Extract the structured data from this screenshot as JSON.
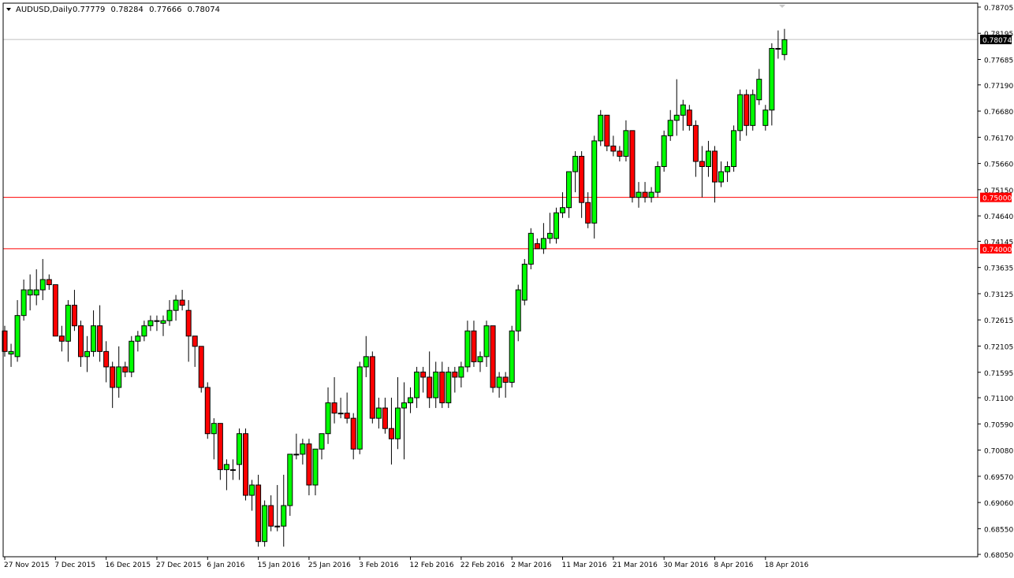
{
  "window": {
    "symbol": "AUDUSD,Daily",
    "ohlc": [
      "0.77779",
      "0.78284",
      "0.77666",
      "0.78074"
    ]
  },
  "colors": {
    "bull": "#00ff00",
    "bear": "#ff0000",
    "outline": "#000000",
    "level_line": "#ff0000",
    "current_line": "#c0c0c0",
    "background": "#ffffff"
  },
  "chart_data": {
    "type": "candlestick",
    "grid": false,
    "ylim": [
      0.6805,
      0.7872
    ],
    "y_ticks": [
      "0.78705",
      "0.78195",
      "0.77685",
      "0.77190",
      "0.76680",
      "0.76170",
      "0.75660",
      "0.75150",
      "0.74640",
      "0.74145",
      "0.73635",
      "0.73125",
      "0.72615",
      "0.72105",
      "0.71595",
      "0.71100",
      "0.70590",
      "0.70080",
      "0.69570",
      "0.69060",
      "0.68550",
      "0.68050"
    ],
    "x_labels": [
      {
        "index": 0,
        "label": "27 Nov 2015"
      },
      {
        "index": 8,
        "label": "7 Dec 2015"
      },
      {
        "index": 16,
        "label": "16 Dec 2015"
      },
      {
        "index": 24,
        "label": "27 Dec 2015"
      },
      {
        "index": 32,
        "label": "6 Jan 2016"
      },
      {
        "index": 40,
        "label": "15 Jan 2016"
      },
      {
        "index": 48,
        "label": "25 Jan 2016"
      },
      {
        "index": 56,
        "label": "3 Feb 2016"
      },
      {
        "index": 64,
        "label": "12 Feb 2016"
      },
      {
        "index": 72,
        "label": "22 Feb 2016"
      },
      {
        "index": 80,
        "label": "2 Mar 2016"
      },
      {
        "index": 88,
        "label": "11 Mar 2016"
      },
      {
        "index": 96,
        "label": "21 Mar 2016"
      },
      {
        "index": 104,
        "label": "30 Mar 2016"
      },
      {
        "index": 112,
        "label": "8 Apr 2016"
      },
      {
        "index": 120,
        "label": "18 Apr 2016"
      }
    ],
    "horizontal_lines": [
      {
        "value": 0.75,
        "label": "0.75000"
      },
      {
        "value": 0.74,
        "label": "0.74000"
      }
    ],
    "current_price": {
      "value": 0.78074,
      "label": "0.78074"
    },
    "candles": [
      [
        0.724,
        0.725,
        0.719,
        0.72
      ],
      [
        0.7195,
        0.7215,
        0.717,
        0.72
      ],
      [
        0.719,
        0.73,
        0.718,
        0.727
      ],
      [
        0.727,
        0.734,
        0.726,
        0.732
      ],
      [
        0.731,
        0.735,
        0.728,
        0.732
      ],
      [
        0.731,
        0.736,
        0.729,
        0.732
      ],
      [
        0.732,
        0.738,
        0.73,
        0.734
      ],
      [
        0.734,
        0.735,
        0.732,
        0.733
      ],
      [
        0.733,
        0.733,
        0.724,
        0.723
      ],
      [
        0.723,
        0.725,
        0.72,
        0.722
      ],
      [
        0.722,
        0.73,
        0.718,
        0.729
      ],
      [
        0.729,
        0.732,
        0.724,
        0.725
      ],
      [
        0.725,
        0.726,
        0.717,
        0.719
      ],
      [
        0.719,
        0.723,
        0.716,
        0.72
      ],
      [
        0.72,
        0.728,
        0.719,
        0.725
      ],
      [
        0.725,
        0.729,
        0.718,
        0.72
      ],
      [
        0.72,
        0.722,
        0.714,
        0.717
      ],
      [
        0.717,
        0.718,
        0.709,
        0.713
      ],
      [
        0.713,
        0.721,
        0.711,
        0.717
      ],
      [
        0.717,
        0.718,
        0.715,
        0.716
      ],
      [
        0.716,
        0.723,
        0.715,
        0.722
      ],
      [
        0.722,
        0.724,
        0.72,
        0.723
      ],
      [
        0.723,
        0.726,
        0.722,
        0.725
      ],
      [
        0.725,
        0.727,
        0.724,
        0.726
      ],
      [
        0.726,
        0.727,
        0.724,
        0.726
      ],
      [
        0.7255,
        0.727,
        0.723,
        0.726
      ],
      [
        0.726,
        0.73,
        0.725,
        0.728
      ],
      [
        0.728,
        0.731,
        0.726,
        0.73
      ],
      [
        0.73,
        0.732,
        0.728,
        0.729
      ],
      [
        0.728,
        0.73,
        0.718,
        0.723
      ],
      [
        0.723,
        0.723,
        0.717,
        0.721
      ],
      [
        0.721,
        0.721,
        0.712,
        0.713
      ],
      [
        0.713,
        0.714,
        0.703,
        0.704
      ],
      [
        0.704,
        0.707,
        0.699,
        0.706
      ],
      [
        0.706,
        0.706,
        0.695,
        0.697
      ],
      [
        0.697,
        0.699,
        0.693,
        0.698
      ],
      [
        0.697,
        0.699,
        0.695,
        0.697
      ],
      [
        0.698,
        0.705,
        0.695,
        0.704
      ],
      [
        0.704,
        0.705,
        0.691,
        0.692
      ],
      [
        0.692,
        0.695,
        0.689,
        0.694
      ],
      [
        0.694,
        0.696,
        0.682,
        0.683
      ],
      [
        0.683,
        0.691,
        0.682,
        0.69
      ],
      [
        0.69,
        0.692,
        0.685,
        0.686
      ],
      [
        0.686,
        0.694,
        0.685,
        0.686
      ],
      [
        0.686,
        0.696,
        0.682,
        0.69
      ],
      [
        0.69,
        0.7,
        0.688,
        0.7
      ],
      [
        0.7,
        0.704,
        0.699,
        0.7
      ],
      [
        0.7,
        0.703,
        0.698,
        0.702
      ],
      [
        0.702,
        0.703,
        0.692,
        0.694
      ],
      [
        0.694,
        0.701,
        0.692,
        0.701
      ],
      [
        0.701,
        0.704,
        0.699,
        0.704
      ],
      [
        0.704,
        0.713,
        0.702,
        0.71
      ],
      [
        0.71,
        0.715,
        0.706,
        0.708
      ],
      [
        0.708,
        0.711,
        0.707,
        0.708
      ],
      [
        0.708,
        0.712,
        0.706,
        0.707
      ],
      [
        0.707,
        0.708,
        0.699,
        0.701
      ],
      [
        0.701,
        0.718,
        0.7,
        0.717
      ],
      [
        0.717,
        0.723,
        0.715,
        0.719
      ],
      [
        0.719,
        0.72,
        0.706,
        0.707
      ],
      [
        0.707,
        0.711,
        0.705,
        0.709
      ],
      [
        0.709,
        0.711,
        0.704,
        0.705
      ],
      [
        0.705,
        0.711,
        0.698,
        0.703
      ],
      [
        0.703,
        0.715,
        0.701,
        0.709
      ],
      [
        0.709,
        0.714,
        0.699,
        0.71
      ],
      [
        0.71,
        0.713,
        0.708,
        0.711
      ],
      [
        0.711,
        0.717,
        0.709,
        0.716
      ],
      [
        0.716,
        0.717,
        0.712,
        0.715
      ],
      [
        0.715,
        0.72,
        0.709,
        0.711
      ],
      [
        0.711,
        0.718,
        0.709,
        0.716
      ],
      [
        0.716,
        0.718,
        0.709,
        0.71
      ],
      [
        0.71,
        0.717,
        0.709,
        0.716
      ],
      [
        0.716,
        0.717,
        0.712,
        0.715
      ],
      [
        0.715,
        0.718,
        0.713,
        0.717
      ],
      [
        0.717,
        0.726,
        0.716,
        0.724
      ],
      [
        0.724,
        0.726,
        0.717,
        0.718
      ],
      [
        0.718,
        0.72,
        0.716,
        0.719
      ],
      [
        0.719,
        0.726,
        0.717,
        0.725
      ],
      [
        0.725,
        0.725,
        0.712,
        0.713
      ],
      [
        0.713,
        0.716,
        0.711,
        0.715
      ],
      [
        0.715,
        0.716,
        0.711,
        0.714
      ],
      [
        0.714,
        0.725,
        0.713,
        0.724
      ],
      [
        0.724,
        0.733,
        0.722,
        0.732
      ],
      [
        0.73,
        0.738,
        0.729,
        0.737
      ],
      [
        0.737,
        0.744,
        0.736,
        0.743
      ],
      [
        0.741,
        0.742,
        0.74,
        0.74
      ],
      [
        0.74,
        0.745,
        0.739,
        0.742
      ],
      [
        0.742,
        0.747,
        0.741,
        0.743
      ],
      [
        0.742,
        0.748,
        0.741,
        0.747
      ],
      [
        0.747,
        0.751,
        0.746,
        0.748
      ],
      [
        0.748,
        0.755,
        0.746,
        0.755
      ],
      [
        0.755,
        0.759,
        0.751,
        0.758
      ],
      [
        0.758,
        0.759,
        0.746,
        0.749
      ],
      [
        0.749,
        0.751,
        0.744,
        0.745
      ],
      [
        0.745,
        0.762,
        0.742,
        0.761
      ],
      [
        0.761,
        0.767,
        0.76,
        0.766
      ],
      [
        0.766,
        0.766,
        0.759,
        0.76
      ],
      [
        0.76,
        0.762,
        0.758,
        0.759
      ],
      [
        0.759,
        0.76,
        0.757,
        0.758
      ],
      [
        0.758,
        0.765,
        0.757,
        0.763
      ],
      [
        0.763,
        0.763,
        0.749,
        0.75
      ],
      [
        0.75,
        0.753,
        0.748,
        0.751
      ],
      [
        0.751,
        0.753,
        0.749,
        0.75
      ],
      [
        0.75,
        0.752,
        0.749,
        0.751
      ],
      [
        0.751,
        0.757,
        0.75,
        0.756
      ],
      [
        0.756,
        0.763,
        0.755,
        0.762
      ],
      [
        0.762,
        0.767,
        0.761,
        0.765
      ],
      [
        0.765,
        0.773,
        0.762,
        0.766
      ],
      [
        0.766,
        0.769,
        0.763,
        0.768
      ],
      [
        0.767,
        0.768,
        0.763,
        0.764
      ],
      [
        0.764,
        0.765,
        0.754,
        0.757
      ],
      [
        0.757,
        0.76,
        0.75,
        0.756
      ],
      [
        0.756,
        0.761,
        0.754,
        0.759
      ],
      [
        0.759,
        0.76,
        0.749,
        0.753
      ],
      [
        0.753,
        0.757,
        0.752,
        0.755
      ],
      [
        0.755,
        0.757,
        0.753,
        0.756
      ],
      [
        0.756,
        0.764,
        0.755,
        0.763
      ],
      [
        0.763,
        0.771,
        0.761,
        0.77
      ],
      [
        0.77,
        0.771,
        0.762,
        0.764
      ],
      [
        0.764,
        0.771,
        0.763,
        0.77
      ],
      [
        0.769,
        0.775,
        0.768,
        0.773
      ],
      [
        0.764,
        0.768,
        0.763,
        0.767
      ],
      [
        0.767,
        0.78,
        0.764,
        0.779
      ],
      [
        0.779,
        0.7825,
        0.777,
        0.779
      ],
      [
        0.7778,
        0.7828,
        0.7767,
        0.7807
      ]
    ]
  }
}
